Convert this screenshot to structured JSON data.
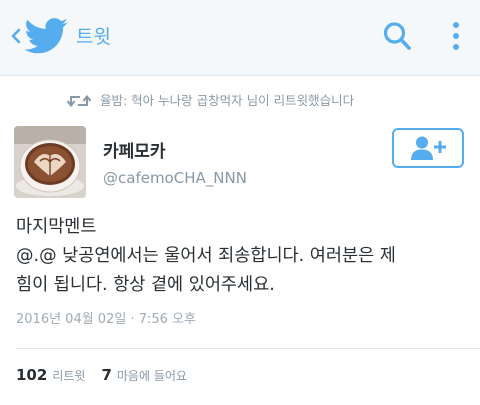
{
  "appbar": {
    "title": "트윗",
    "brand_color": "#55acee",
    "icons": [
      "back-chevron-icon",
      "twitter-bird-icon",
      "search-icon",
      "overflow-menu-icon"
    ]
  },
  "retweet_context": {
    "text": "율밤: 혁아 누나랑 곱창먹자 님이 리트윗했습니다",
    "icon": "retweet-icon"
  },
  "author": {
    "display_name": "카페모카",
    "handle": "@cafemoCHA_NNN",
    "avatar_icon": "avatar-latte-art"
  },
  "follow_button": {
    "icon": "follow-user-plus-icon"
  },
  "tweet": {
    "text": "마지막멘트\n@.@ 낮공연에서는 울어서 죄송합니다. 여러분은 제\n힘이 됩니다. 항상 곁에 있어주세요.",
    "timestamp": "2016년 04월 02일 · 7:56 오후"
  },
  "stats": {
    "retweets_count": "102",
    "retweets_label": "리트윗",
    "likes_count": "7",
    "likes_label": "마음에 들어요"
  }
}
